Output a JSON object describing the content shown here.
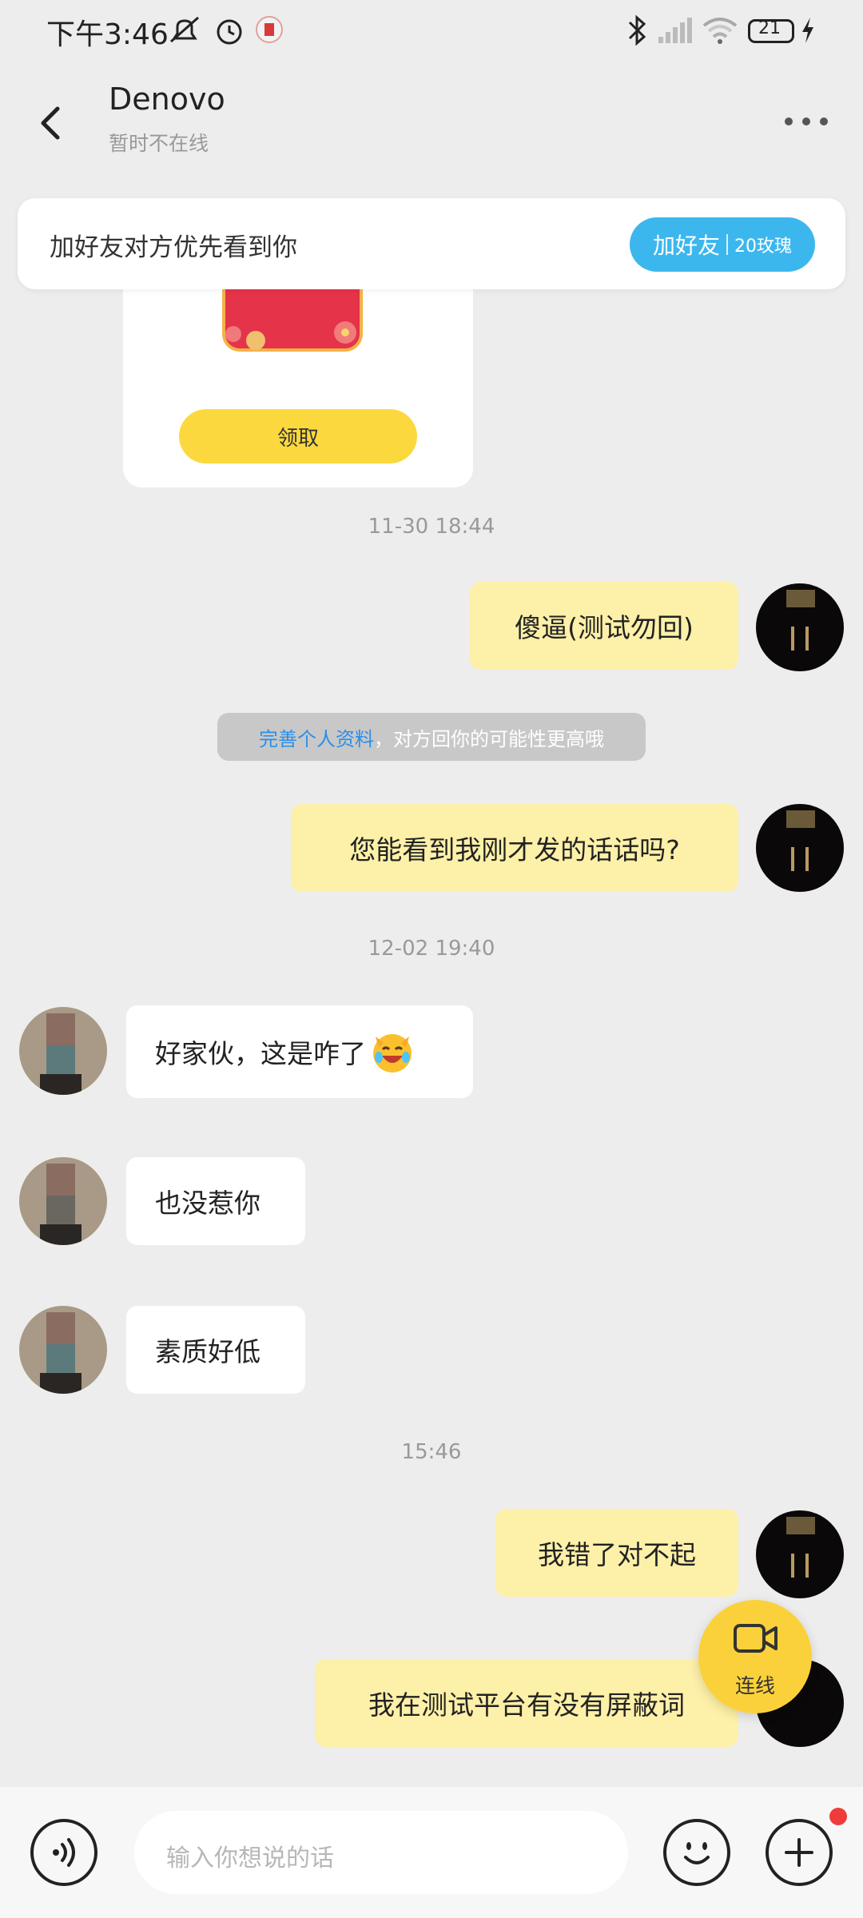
{
  "status_bar": {
    "time": "下午3:46",
    "battery": "21"
  },
  "header": {
    "title": "Denovo",
    "subtitle": "暂时不在线"
  },
  "banner": {
    "text": "加好友对方优先看到你",
    "button_main": "加好友",
    "button_sub": "20玫瑰"
  },
  "card": {
    "claim_label": "领取"
  },
  "timestamps": {
    "t1": "11-30 18:44",
    "t2": "12-02 19:40",
    "t3": "15:46"
  },
  "notice": {
    "link": "完善个人资料",
    "text": "，对方回你的可能性更高哦"
  },
  "messages": {
    "m1": "傻逼(测试勿回)",
    "m2": "您能看到我刚才发的话话吗?",
    "m3": "好家伙，这是咋了",
    "m4": "也没惹你",
    "m5": "素质好低",
    "m6": "我错了对不起",
    "m7": "我在测试平台有没有屏蔽词"
  },
  "call_button": {
    "label": "连线"
  },
  "composer": {
    "placeholder": "输入你想说的话"
  },
  "colors": {
    "accent_blue": "#3cb7ee",
    "my_bubble": "#fdf0a8",
    "claim_yellow": "#fbd93e",
    "background": "#ededed"
  }
}
